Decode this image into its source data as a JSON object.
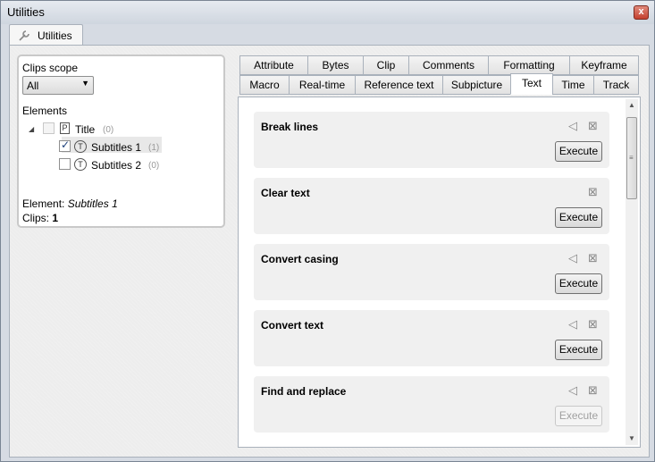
{
  "window": {
    "title": "Utilities",
    "close_glyph": "x"
  },
  "doc_tab": {
    "label": "Utilities",
    "icon": "wrench-icon"
  },
  "scope": {
    "clips_scope_label": "Clips scope",
    "clips_scope_value": "All",
    "elements_label": "Elements",
    "tree": [
      {
        "label": "Title",
        "count": "(0)",
        "checked": false,
        "icon": "P"
      },
      {
        "label": "Subtitles 1",
        "count": "(1)",
        "checked": true,
        "icon": "T"
      },
      {
        "label": "Subtitles 2",
        "count": "(0)",
        "checked": false,
        "icon": "T"
      }
    ],
    "element_label": "Element:",
    "element_value": "Subtitles 1",
    "clips_label": "Clips:",
    "clips_value": "1"
  },
  "tabs_row1": [
    "Attribute",
    "Bytes",
    "Clip",
    "Comments",
    "Formatting",
    "Keyframe"
  ],
  "tabs_row2": [
    "Macro",
    "Real-time",
    "Reference text",
    "Subpicture",
    "Text",
    "Time",
    "Track"
  ],
  "active_tab": "Text",
  "utilities": [
    {
      "name": "Break lines",
      "execute": "Execute",
      "enabled": true,
      "pinnable": true
    },
    {
      "name": "Clear text",
      "execute": "Execute",
      "enabled": true,
      "pinnable": false
    },
    {
      "name": "Convert casing",
      "execute": "Execute",
      "enabled": true,
      "pinnable": true
    },
    {
      "name": "Convert text",
      "execute": "Execute",
      "enabled": true,
      "pinnable": true
    },
    {
      "name": "Find and replace",
      "execute": "Execute",
      "enabled": false,
      "pinnable": true
    }
  ]
}
